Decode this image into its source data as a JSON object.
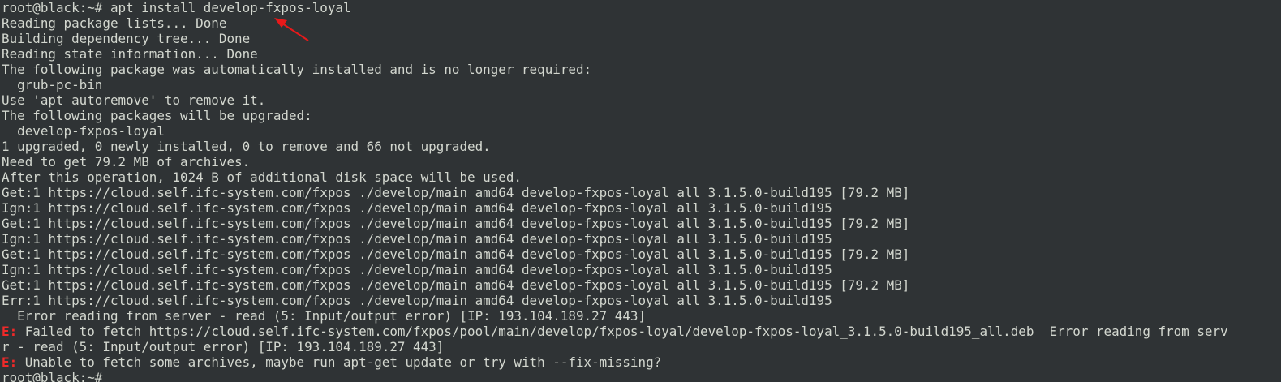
{
  "terminal": {
    "prompt": "root@black:~# ",
    "command": "apt install develop-fxpos-loyal",
    "output": [
      "Reading package lists... Done",
      "Building dependency tree... Done",
      "Reading state information... Done",
      "The following package was automatically installed and is no longer required:",
      "  grub-pc-bin",
      "Use 'apt autoremove' to remove it.",
      "The following packages will be upgraded:",
      "  develop-fxpos-loyal",
      "1 upgraded, 0 newly installed, 0 to remove and 66 not upgraded.",
      "Need to get 79.2 MB of archives.",
      "After this operation, 1024 B of additional disk space will be used.",
      "Get:1 https://cloud.self.ifc-system.com/fxpos ./develop/main amd64 develop-fxpos-loyal all 3.1.5.0-build195 [79.2 MB]",
      "Ign:1 https://cloud.self.ifc-system.com/fxpos ./develop/main amd64 develop-fxpos-loyal all 3.1.5.0-build195",
      "Get:1 https://cloud.self.ifc-system.com/fxpos ./develop/main amd64 develop-fxpos-loyal all 3.1.5.0-build195 [79.2 MB]",
      "Ign:1 https://cloud.self.ifc-system.com/fxpos ./develop/main amd64 develop-fxpos-loyal all 3.1.5.0-build195",
      "Get:1 https://cloud.self.ifc-system.com/fxpos ./develop/main amd64 develop-fxpos-loyal all 3.1.5.0-build195 [79.2 MB]",
      "Ign:1 https://cloud.self.ifc-system.com/fxpos ./develop/main amd64 develop-fxpos-loyal all 3.1.5.0-build195",
      "Get:1 https://cloud.self.ifc-system.com/fxpos ./develop/main amd64 develop-fxpos-loyal all 3.1.5.0-build195 [79.2 MB]",
      "Err:1 https://cloud.self.ifc-system.com/fxpos ./develop/main amd64 develop-fxpos-loyal all 3.1.5.0-build195",
      "  Error reading from server - read (5: Input/output error) [IP: 193.104.189.27 443]"
    ],
    "error1": {
      "prefix": "E:",
      "text": " Failed to fetch https://cloud.self.ifc-system.com/fxpos/pool/main/develop/fxpos-loyal/develop-fxpos-loyal_3.1.5.0-build195_all.deb  Error reading from serv",
      "continuation": "r - read (5: Input/output error) [IP: 193.104.189.27 443]"
    },
    "error2": {
      "prefix": "E:",
      "text": " Unable to fetch some archives, maybe run apt-get update or try with --fix-missing?"
    },
    "final_prompt": "root@black:~# "
  },
  "colors": {
    "background": "#2f3335",
    "foreground": "#d3d7cf",
    "error": "#ef2929",
    "annotation_arrow": "#e8191a"
  },
  "icons": {
    "annotation": "red-arrow-icon"
  }
}
